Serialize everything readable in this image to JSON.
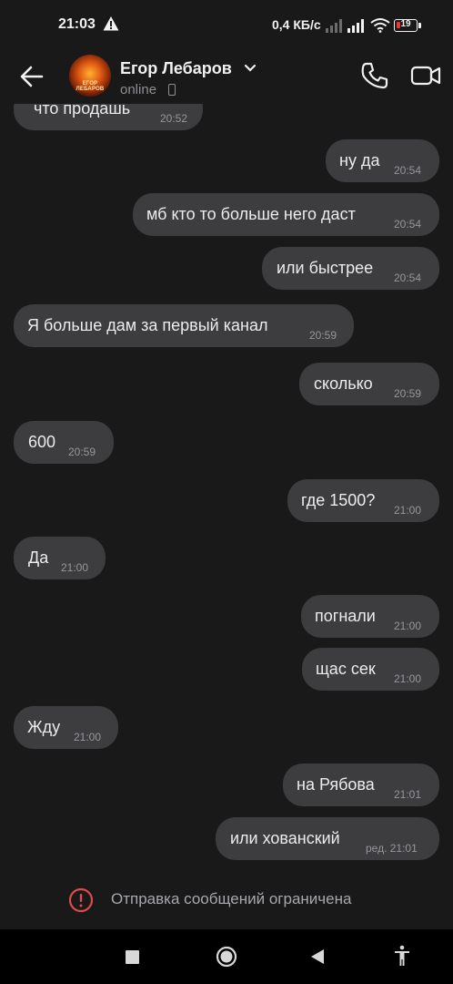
{
  "status_bar": {
    "time": "21:03",
    "net_speed": "0,4 КБ/с",
    "battery": "19"
  },
  "header": {
    "name": "Егор Лебаров",
    "status": "online",
    "avatar_text": "ЕГОР ЛЕБАРОВ"
  },
  "messages": [
    {
      "dir": "in",
      "text": "что продашь",
      "time": "20:52"
    },
    {
      "dir": "out",
      "text": "ну да",
      "time": "20:54"
    },
    {
      "dir": "out",
      "text": "мб кто то больше него даст",
      "time": "20:54"
    },
    {
      "dir": "out",
      "text": "или быстрее",
      "time": "20:54"
    },
    {
      "dir": "in",
      "text": "Я больше дам за первый канал",
      "time": "20:59"
    },
    {
      "dir": "out",
      "text": "сколько",
      "time": "20:59"
    },
    {
      "dir": "in",
      "text": "600",
      "time": "20:59"
    },
    {
      "dir": "out",
      "text": "где 1500?",
      "time": "21:00"
    },
    {
      "dir": "in",
      "text": "Да",
      "time": "21:00"
    },
    {
      "dir": "out",
      "text": "погнали",
      "time": "21:00"
    },
    {
      "dir": "out",
      "text": "щас сек",
      "time": "21:00"
    },
    {
      "dir": "in",
      "text": "Жду",
      "time": "21:00"
    },
    {
      "dir": "out",
      "text": "на Рябова",
      "time": "21:01"
    },
    {
      "dir": "out",
      "text": "или хованский",
      "time": "ред. 21:01"
    }
  ],
  "restriction": {
    "text": "Отправка сообщений ограничена",
    "color": "#e04a4a"
  },
  "colors": {
    "background": "#19191a",
    "bubble": "#3d3d3f",
    "text": "#ececec",
    "muted": "#96969b"
  }
}
